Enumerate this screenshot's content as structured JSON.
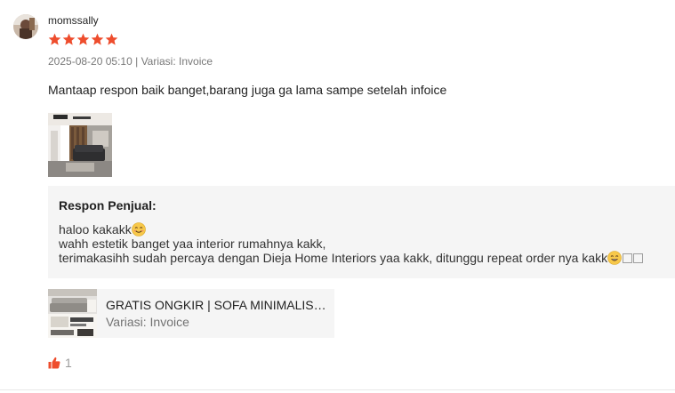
{
  "review": {
    "username": "momssally",
    "rating": 5,
    "rating_max": 5,
    "date": "2025-08-20 05:10",
    "separator": "|",
    "variant_label": "Variasi: Invoice",
    "text": "Mantaap respon baik banget,barang juga ga lama sampe setelah infoice",
    "photo_count": 1
  },
  "seller_response": {
    "title": "Respon Penjual:",
    "line1": "haloo kakakk",
    "line2": "wahh estetik banget yaa interior rumahnya kakk,",
    "line3": "terimakasihh sudah percaya dengan Dieja Home Interiors yaa kakk, ditunggu repeat order nya kakk"
  },
  "product": {
    "name": "GRATIS ONGKIR | SOFA MINIMALIS | SOFA BED",
    "variant": "Variasi: Invoice"
  },
  "likes": {
    "count": "1"
  },
  "colors": {
    "star": "#ee4d2d",
    "like": "#ee4d2d",
    "response_bg": "#f5f5f5"
  },
  "icons": {
    "star": "star-icon",
    "like": "thumbs-up-icon",
    "emoji1": "smiling-face-icon",
    "emoji2": "grinning-face-icon"
  }
}
